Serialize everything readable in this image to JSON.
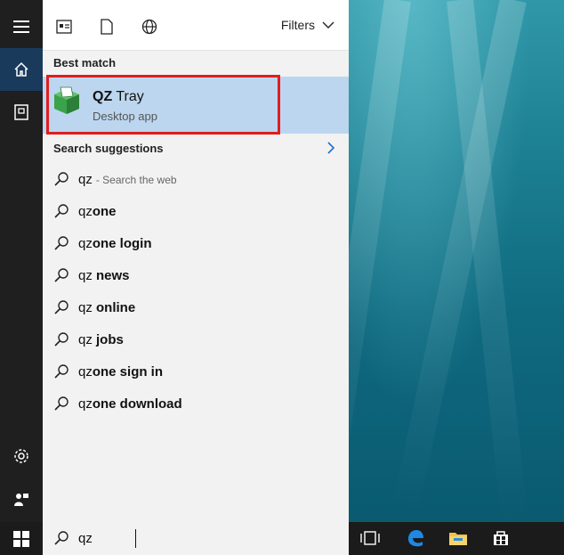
{
  "panel": {
    "filters_label": "Filters",
    "best_match_label": "Best match",
    "app": {
      "name_bold": "QZ",
      "name_rest": " Tray",
      "subtitle": "Desktop app"
    },
    "suggestions_label": "Search suggestions",
    "suggestions": [
      {
        "typed": "qz",
        "rest": "",
        "hint": "- Search the web"
      },
      {
        "typed": "qz",
        "rest": "one",
        "hint": ""
      },
      {
        "typed": "qz",
        "rest": "one login",
        "hint": ""
      },
      {
        "typed": "qz",
        "rest": " news",
        "hint": ""
      },
      {
        "typed": "qz",
        "rest": " online",
        "hint": ""
      },
      {
        "typed": "qz",
        "rest": " jobs",
        "hint": ""
      },
      {
        "typed": "qz",
        "rest": "one sign in",
        "hint": ""
      },
      {
        "typed": "qz",
        "rest": "one download",
        "hint": ""
      }
    ]
  },
  "searchbox": {
    "query": "qz"
  },
  "icons": {
    "rail": [
      "hamburger-icon",
      "home-icon",
      "documents-icon",
      "settings-icon",
      "user-feedback-icon"
    ],
    "top": [
      "apps-filter-icon",
      "documents-filter-icon",
      "web-filter-icon"
    ],
    "taskbar": [
      "windows-start-icon",
      "task-view-icon",
      "edge-icon",
      "file-explorer-icon",
      "store-icon"
    ]
  },
  "colors": {
    "highlight": "#e11d1d",
    "selection": "#bcd6ef",
    "rail_active": "#1a3a5c",
    "app_green": "#3aa24a"
  }
}
